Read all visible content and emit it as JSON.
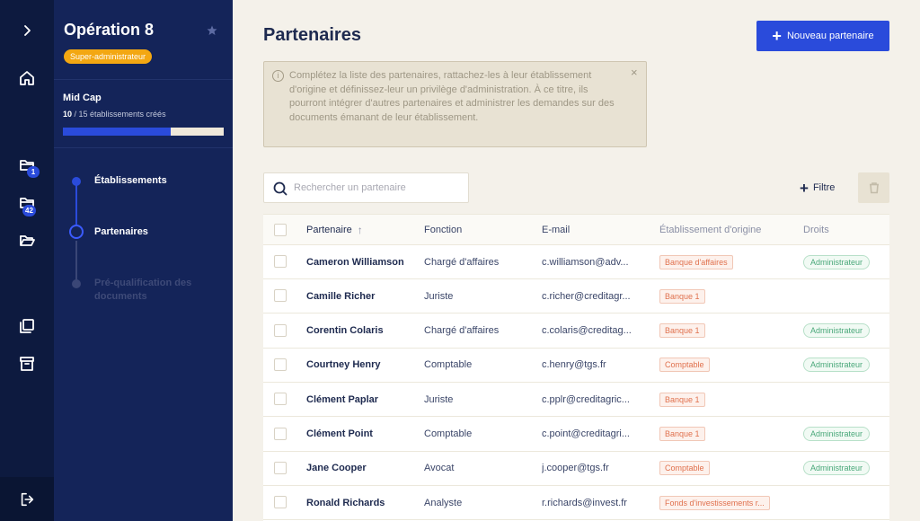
{
  "rail": {
    "badges": {
      "folder1": "1",
      "folder2": "42"
    }
  },
  "sidebar": {
    "operation_title": "Opération 8",
    "role": "Super-administrateur",
    "cap_name": "Mid Cap",
    "cap_created": "10",
    "cap_total_text": " / 15 établissements créés",
    "cap_progress": 0.67,
    "steps": [
      {
        "label": "Établissements",
        "state": "done"
      },
      {
        "label": "Partenaires",
        "state": "current"
      },
      {
        "label": "Pré-qualification des documents",
        "state": "disabled"
      }
    ]
  },
  "main": {
    "title": "Partenaires",
    "new_button": "Nouveau partenaire",
    "info_text": "Complétez la liste des partenaires, rattachez-les à leur établissement d'origine et définissez-leur un privilège d'administration. À ce titre, ils pourront intégrer d'autres partenaires et administrer les demandes sur des documents émanant de leur établissement.",
    "close_glyph": "×",
    "search_placeholder": "Rechercher un partenaire",
    "filter_label": "Filtre",
    "columns": {
      "name": "Partenaire",
      "function": "Fonction",
      "email": "E-mail",
      "etablissement": "Établissement d'origine",
      "droits": "Droits"
    },
    "rows": [
      {
        "name": "Cameron Williamson",
        "function": "Chargé d'affaires",
        "email": "c.williamson@adv...",
        "etablissement": "Banque d'affaires",
        "droits": "Administrateur"
      },
      {
        "name": "Camille Richer",
        "function": "Juriste",
        "email": "c.richer@creditagr...",
        "etablissement": "Banque 1",
        "droits": ""
      },
      {
        "name": "Corentin Colaris",
        "function": "Chargé d'affaires",
        "email": "c.colaris@creditag...",
        "etablissement": "Banque 1",
        "droits": "Administrateur"
      },
      {
        "name": "Courtney Henry",
        "function": "Comptable",
        "email": "c.henry@tgs.fr",
        "etablissement": "Comptable",
        "droits": "Administrateur"
      },
      {
        "name": "Clément Paplar",
        "function": "Juriste",
        "email": "c.pplr@creditagric...",
        "etablissement": "Banque 1",
        "droits": ""
      },
      {
        "name": "Clément Point",
        "function": "Comptable",
        "email": "c.point@creditagri...",
        "etablissement": "Banque 1",
        "droits": "Administrateur"
      },
      {
        "name": "Jane Cooper",
        "function": "Avocat",
        "email": "j.cooper@tgs.fr",
        "etablissement": "Comptable",
        "droits": "Administrateur"
      },
      {
        "name": "Ronald Richards",
        "function": "Analyste",
        "email": "r.richards@invest.fr",
        "etablissement": "Fonds d'investissements r...",
        "droits": ""
      }
    ]
  },
  "colors": {
    "rail_bg": "#0d1a3f",
    "sidebar_bg": "#142459",
    "accent": "#2a4bdb",
    "role_pill": "#f3a712",
    "page_bg": "#f4f1ea"
  }
}
